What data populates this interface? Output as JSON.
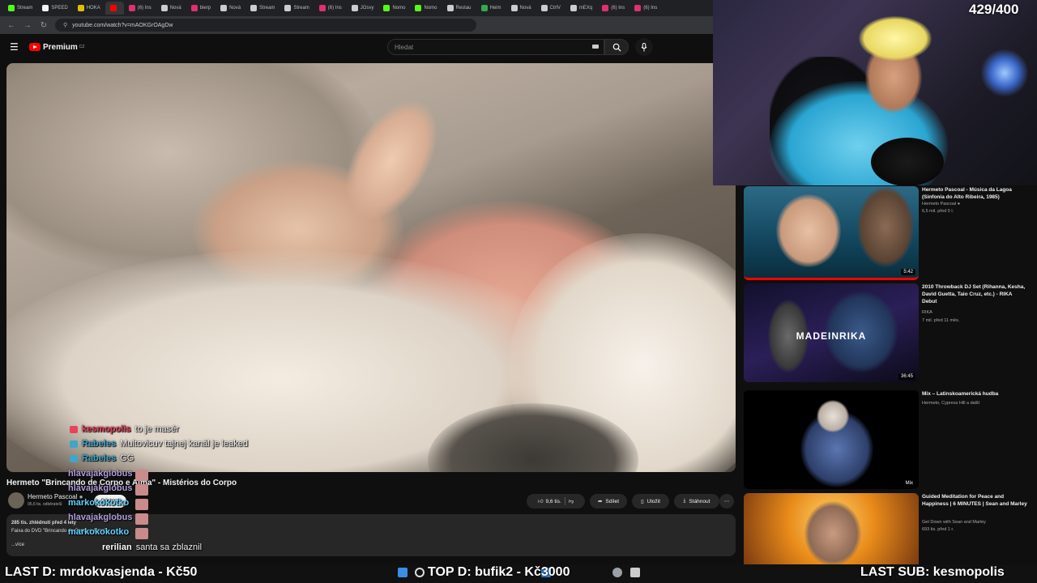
{
  "browser": {
    "tabs": [
      {
        "label": "Stream",
        "color": "#53fc18"
      },
      {
        "label": "SPEED",
        "color": "#f5f5f5"
      },
      {
        "label": "HOKA",
        "color": "#e0c000"
      },
      {
        "label": "",
        "color": "#ff0000"
      },
      {
        "label": "(6) Ins",
        "color": "#e1306c"
      },
      {
        "label": "Nová",
        "color": "#cccccc"
      },
      {
        "label": "bierp",
        "color": "#e1306c"
      },
      {
        "label": "Nová",
        "color": "#cccccc"
      },
      {
        "label": "Stream",
        "color": "#cccccc"
      },
      {
        "label": "Stream",
        "color": "#cccccc"
      },
      {
        "label": "(6) Ins",
        "color": "#e1306c"
      },
      {
        "label": "JOsvy",
        "color": "#cccccc"
      },
      {
        "label": "Nomo",
        "color": "#53fc18"
      },
      {
        "label": "Nomo",
        "color": "#53fc18"
      },
      {
        "label": "Restau",
        "color": "#cccccc"
      },
      {
        "label": "Heim",
        "color": "#34a853"
      },
      {
        "label": "Nová",
        "color": "#cccccc"
      },
      {
        "label": "CtrlV",
        "color": "#cccccc"
      },
      {
        "label": "mEXq",
        "color": "#cccccc"
      },
      {
        "label": "(6) Ins",
        "color": "#e1306c"
      },
      {
        "label": "(6) Ins",
        "color": "#e1306c"
      }
    ],
    "url": "youtube.com/watch?v=mAOKGrOAgDw"
  },
  "youtube": {
    "logo_text": "Premium",
    "logo_region": "CZ",
    "search_placeholder": "Hledat",
    "video_title": "Hermeto \"Brincando de Corpo e Alma\" - Mistérios do Corpo",
    "channel_name": "Hermeto Pascoal",
    "channel_subs": "95,6 tis. odběratelů",
    "subscribe_label": "Odebírat",
    "like_count": "9,6 tis.",
    "share_label": "Sdílet",
    "save_label": "Uložit",
    "download_label": "Stáhnout",
    "desc_stats": "285 tis. zhlédnutí  před 4 lety",
    "desc_line": "Faixa do DVD \"Brincando de Corpo e Alma\"",
    "desc_more": "...více"
  },
  "recommendations": [
    {
      "title": "Hermeto Pascoal - Música da Lagoa (Sinfonia do Alto Ribeira, 1985)",
      "channel": "Hermeto Pascoal",
      "stats": "6,5 mil.  před 5 l.",
      "duration": "5:42"
    },
    {
      "title": "2010 Throwback DJ Set (Rihanna, Kesha, David Guetta, Taio Cruz, etc.) - RIKA Debut",
      "channel": "RIKA",
      "stats": "7 mil.  před 11 měs.",
      "duration": "36:45",
      "overlay": "MADEINRIKA"
    },
    {
      "title": "Mix – Latinskoamerická hudba",
      "channel": "Hermeto, Cypress Hill a další",
      "stats": "",
      "duration": "Mix"
    },
    {
      "title": "Guided Meditation for Peace and Happiness | 6 MINUTES | Sean and Marley",
      "channel": "Get Down with Sean and Marley",
      "stats": "693 tis.  před 1 r.",
      "duration": ""
    }
  ],
  "chat": [
    {
      "user": "kesmopolis",
      "message": "to je masér",
      "color": "#e8415b"
    },
    {
      "user": "Rabeles",
      "message": "Multovicuv tajnej kanál je leaked",
      "color": "#3ea6c9"
    },
    {
      "user": "Rabeles",
      "message": "GG",
      "color": "#3ea6c9"
    },
    {
      "user": "rerilian",
      "message": "santa sa zblaznil",
      "color": "#ffffff"
    }
  ],
  "chat_spam": [
    "hlavajakglobus",
    "hlavajakglobus",
    "markokokotko",
    "hlavajakglobus",
    "markokokotko"
  ],
  "stream": {
    "counter": "429/400",
    "last_donation": "LAST D: mrdokvasjenda - Kč50",
    "top_donation": "TOP D: bufik2 - Kč3000",
    "last_sub": "LAST SUB: kesmopolis"
  },
  "colors": {
    "youtube_red": "#ff0000",
    "background": "#0f0f0f",
    "progress": "#ff0000"
  }
}
